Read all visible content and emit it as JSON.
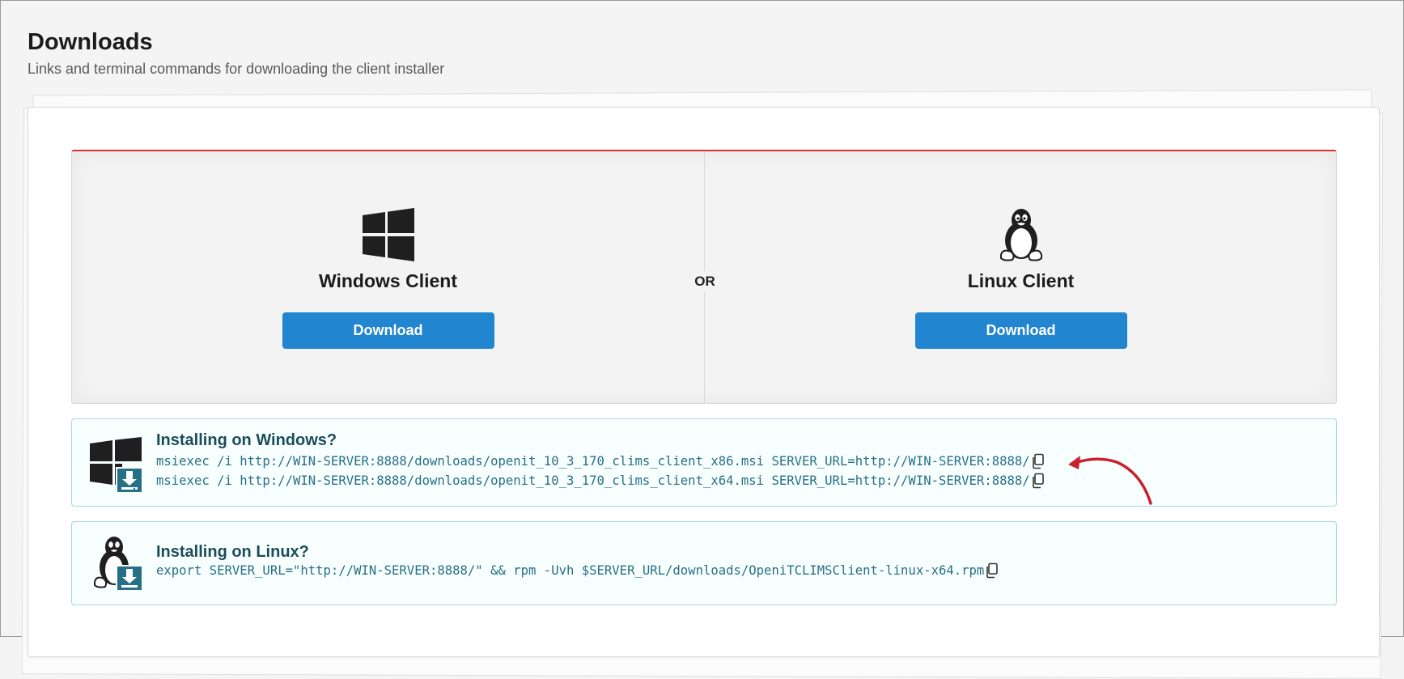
{
  "page": {
    "title": "Downloads",
    "subtitle": "Links and terminal commands for downloading the client installer"
  },
  "clients": {
    "or_label": "OR",
    "windows": {
      "name": "Windows Client",
      "button_label": "Download",
      "icon": "windows-logo-icon"
    },
    "linux": {
      "name": "Linux Client",
      "button_label": "Download",
      "icon": "linux-tux-icon"
    }
  },
  "instructions": {
    "windows": {
      "header": "Installing on Windows?",
      "icon": "windows-download-icon",
      "commands": [
        "msiexec /i http://WIN-SERVER:8888/downloads/openit_10_3_170_clims_client_x86.msi SERVER_URL=http://WIN-SERVER:8888/",
        "msiexec /i http://WIN-SERVER:8888/downloads/openit_10_3_170_clims_client_x64.msi SERVER_URL=http://WIN-SERVER:8888/"
      ]
    },
    "linux": {
      "header": "Installing on Linux?",
      "icon": "linux-download-icon",
      "commands": [
        "export SERVER_URL=\"http://WIN-SERVER:8888/\" && rpm -Uvh $SERVER_URL/downloads/OpeniTCLIMSClient-linux-x64.rpm"
      ]
    }
  },
  "annotation": {
    "icon": "red-arrow-pointer",
    "color": "#c8202f"
  },
  "colors": {
    "accent_red": "#d9322f",
    "button_blue": "#2185d0",
    "info_text": "#276f86",
    "info_header": "#1b4c5a",
    "info_bg": "#f8ffff",
    "info_border": "#a9d5de"
  }
}
